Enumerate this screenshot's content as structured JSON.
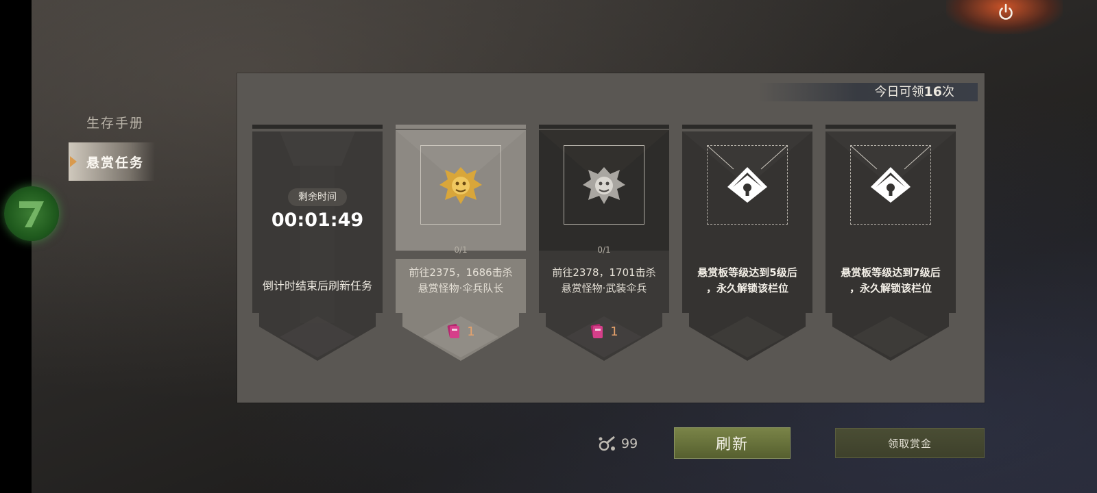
{
  "sidebar": {
    "items": [
      {
        "label": "生存手册",
        "active": false
      },
      {
        "label": "悬赏任务",
        "active": true
      }
    ]
  },
  "header": {
    "quota_prefix": "今日可领",
    "quota_count": "16",
    "quota_suffix": "次"
  },
  "slots": [
    {
      "type": "timer",
      "timer_label": "剩余时间",
      "timer_value": "00:01:49",
      "note": "倒计时结束后刷新任务"
    },
    {
      "type": "task",
      "progress": "0/1",
      "line1": "前往2375，1686击杀",
      "line2": "悬赏怪物·伞兵队长",
      "reward_count": "1",
      "badge": "gold-beast-icon"
    },
    {
      "type": "task",
      "progress": "0/1",
      "line1": "前往2378，1701击杀",
      "line2": "悬赏怪物·武装伞兵",
      "reward_count": "1",
      "badge": "silver-beast-icon"
    },
    {
      "type": "locked",
      "line1": "悬赏板等级达到5级后",
      "line2": "，永久解锁该栏位",
      "icon": "lock-icon"
    },
    {
      "type": "locked",
      "line1": "悬赏板等级达到7级后",
      "line2": "，永久解锁该栏位",
      "icon": "lock-icon"
    }
  ],
  "footer": {
    "currency_count": "99",
    "refresh_label": "刷新",
    "claim_label": "领取赏金"
  },
  "colors": {
    "panel": "#5a5753",
    "accent_orange": "#d99a4e",
    "refresh_green": "#6b7540",
    "reward_number": "#e7a36c"
  }
}
